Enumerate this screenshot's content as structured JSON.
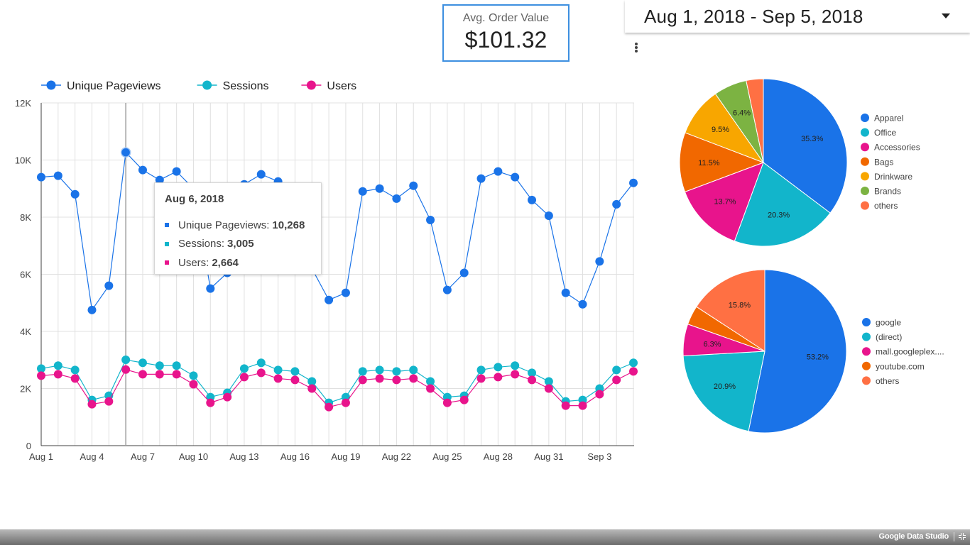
{
  "kpi": {
    "label": "Avg. Order Value",
    "value": "$101.32"
  },
  "date_range": {
    "value": "Aug 1, 2018 - Sep 5, 2018"
  },
  "tooltip": {
    "title": "Aug 6, 2018",
    "rows": [
      {
        "label": "Unique Pageviews:",
        "value": "10,268",
        "color": "#1a73e8"
      },
      {
        "label": "Sessions:",
        "value": "3,005",
        "color": "#12b5cb"
      },
      {
        "label": "Users:",
        "value": "2,664",
        "color": "#e8148c"
      }
    ]
  },
  "footer": {
    "brand": "Google Data Studio"
  },
  "chart_data": [
    {
      "type": "line",
      "x": [
        "Aug 1",
        "Aug 2",
        "Aug 3",
        "Aug 4",
        "Aug 5",
        "Aug 6",
        "Aug 7",
        "Aug 8",
        "Aug 9",
        "Aug 10",
        "Aug 11",
        "Aug 12",
        "Aug 13",
        "Aug 14",
        "Aug 15",
        "Aug 16",
        "Aug 17",
        "Aug 18",
        "Aug 19",
        "Aug 20",
        "Aug 21",
        "Aug 22",
        "Aug 23",
        "Aug 24",
        "Aug 25",
        "Aug 26",
        "Aug 27",
        "Aug 28",
        "Aug 29",
        "Aug 30",
        "Aug 31",
        "Sep 1",
        "Sep 2",
        "Sep 3",
        "Sep 4",
        "Sep 5"
      ],
      "x_tick_labels": [
        "Aug 1",
        "Aug 4",
        "Aug 7",
        "Aug 10",
        "Aug 13",
        "Aug 16",
        "Aug 19",
        "Aug 22",
        "Aug 25",
        "Aug 28",
        "Aug 31",
        "Sep 3"
      ],
      "y_tick_labels": [
        "0",
        "2K",
        "4K",
        "6K",
        "8K",
        "10K",
        "12K"
      ],
      "ylim": [
        0,
        12000
      ],
      "grid": true,
      "legend_position": "top-left",
      "highlighted_x": "Aug 6",
      "series": [
        {
          "name": "Unique Pageviews",
          "color": "#1a73e8",
          "values": [
            9400,
            9450,
            8800,
            4750,
            5600,
            10268,
            9650,
            9300,
            9600,
            9000,
            5500,
            6050,
            9150,
            9500,
            9250,
            8000,
            6200,
            5100,
            5350,
            8900,
            9000,
            8650,
            9100,
            7900,
            5450,
            6050,
            9350,
            9600,
            9400,
            8600,
            8050,
            5350,
            4950,
            6450,
            8450,
            9200
          ]
        },
        {
          "name": "Sessions",
          "color": "#12b5cb",
          "values": [
            2700,
            2800,
            2650,
            1600,
            1750,
            3005,
            2900,
            2800,
            2800,
            2450,
            1700,
            1850,
            2700,
            2900,
            2650,
            2600,
            2250,
            1500,
            1700,
            2600,
            2650,
            2600,
            2650,
            2250,
            1700,
            1750,
            2650,
            2750,
            2800,
            2550,
            2250,
            1550,
            1600,
            2000,
            2650,
            2900
          ]
        },
        {
          "name": "Users",
          "color": "#e8148c",
          "values": [
            2450,
            2500,
            2350,
            1450,
            1550,
            2664,
            2500,
            2500,
            2500,
            2150,
            1500,
            1700,
            2400,
            2550,
            2350,
            2300,
            2000,
            1350,
            1500,
            2300,
            2350,
            2300,
            2350,
            2000,
            1500,
            1600,
            2350,
            2400,
            2500,
            2300,
            2000,
            1400,
            1400,
            1800,
            2300,
            2600
          ]
        }
      ]
    },
    {
      "type": "pie",
      "slices": [
        {
          "label": "Apparel",
          "value": 35.3,
          "text": "35.3%",
          "color": "#1a73e8"
        },
        {
          "label": "Office",
          "value": 20.3,
          "text": "20.3%",
          "color": "#12b5cb"
        },
        {
          "label": "Accessories",
          "value": 13.7,
          "text": "13.7%",
          "color": "#e8148c"
        },
        {
          "label": "Bags",
          "value": 11.5,
          "text": "11.5%",
          "color": "#f16800"
        },
        {
          "label": "Drinkware",
          "value": 9.5,
          "text": "9.5%",
          "color": "#f8a600"
        },
        {
          "label": "Brands",
          "value": 6.4,
          "text": "6.4%",
          "color": "#7cb342"
        },
        {
          "label": "others",
          "value": 3.3,
          "text": "",
          "color": "#ff7043"
        }
      ],
      "legend_position": "right"
    },
    {
      "type": "pie",
      "slices": [
        {
          "label": "google",
          "value": 53.2,
          "text": "53.2%",
          "color": "#1a73e8"
        },
        {
          "label": "(direct)",
          "value": 20.9,
          "text": "20.9%",
          "color": "#12b5cb"
        },
        {
          "label": "mall.googleplex....",
          "value": 6.3,
          "text": "6.3%",
          "color": "#e8148c"
        },
        {
          "label": "youtube.com",
          "value": 3.8,
          "text": "",
          "color": "#f16800"
        },
        {
          "label": "others",
          "value": 15.8,
          "text": "15.8%",
          "color": "#ff7043"
        }
      ],
      "legend_position": "right"
    }
  ]
}
